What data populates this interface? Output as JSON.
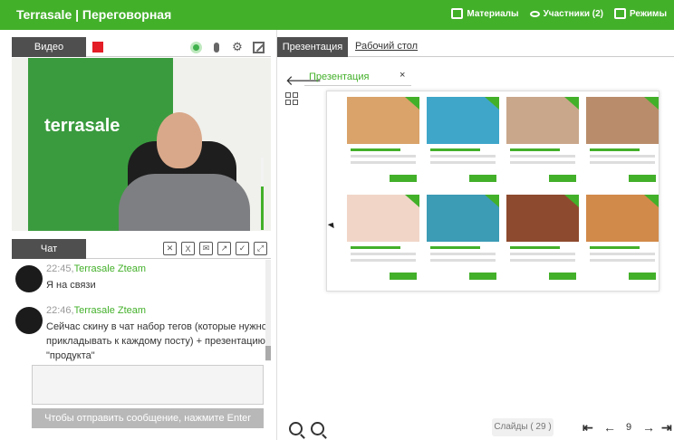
{
  "header": {
    "title": "Terrasale | Переговорная",
    "materials": "Материалы",
    "participants": "Участники (2)",
    "modes": "Режимы"
  },
  "video": {
    "tab": "Видео",
    "brand": "terrasale"
  },
  "chat": {
    "tab": "Чат",
    "messages": [
      {
        "time": "22:45,",
        "author": "Terrasale Zteam",
        "text": "Я на связи"
      },
      {
        "time": "22:46,",
        "author": "Terrasale Zteam",
        "text": "Сейчас скину в чат набор тегов (которые нужно прикладывать к каждому посту) + презентацию \"продукта\""
      }
    ],
    "input_value": "",
    "send_label": "Чтобы отправить сообщение, нажмите Enter"
  },
  "presentation": {
    "tab_active": "Презентация",
    "tab_desktop": "Рабочий стол",
    "field_label": "Презентация",
    "close": "×",
    "slides_label": "Слайды ( 29 )",
    "page": "9"
  },
  "colors": {
    "accent": "#43b02a",
    "record": "#e41e26",
    "tab_bg": "#4f4f4f"
  },
  "icons": {
    "materials": "book-icon",
    "participants": "eye-icon",
    "modes": "layout-icon",
    "camera": "camera-icon",
    "mic": "mic-icon",
    "settings": "gear-icon",
    "expand": "expand-icon"
  }
}
